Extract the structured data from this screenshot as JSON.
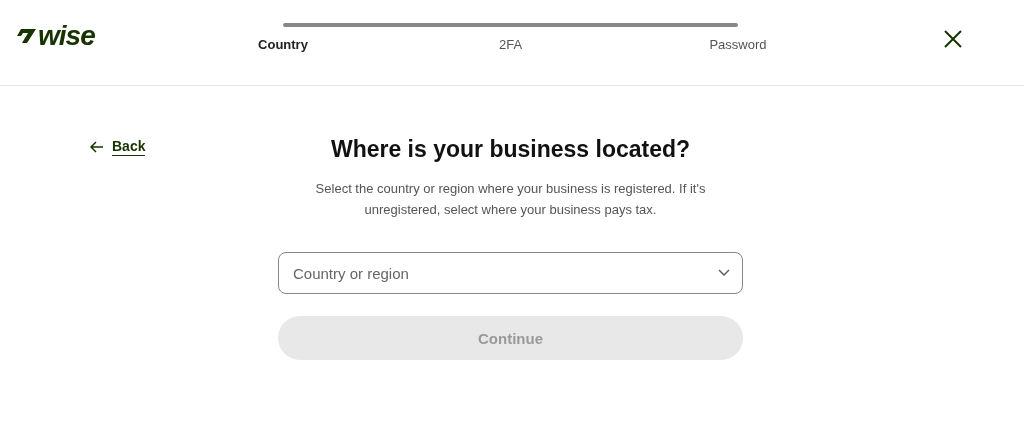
{
  "logo": {
    "text": "wise"
  },
  "steps": [
    {
      "label": "Country",
      "selected": true
    },
    {
      "label": "2FA",
      "selected": false
    },
    {
      "label": "Password",
      "selected": false
    }
  ],
  "back": {
    "label": "Back"
  },
  "heading": "Where is your business located?",
  "description": "Select the country or region where your business is registered. If it's unregistered, select where your business pays tax.",
  "country_select": {
    "placeholder": "Country or region"
  },
  "continue_button": {
    "label": "Continue",
    "disabled": true
  }
}
